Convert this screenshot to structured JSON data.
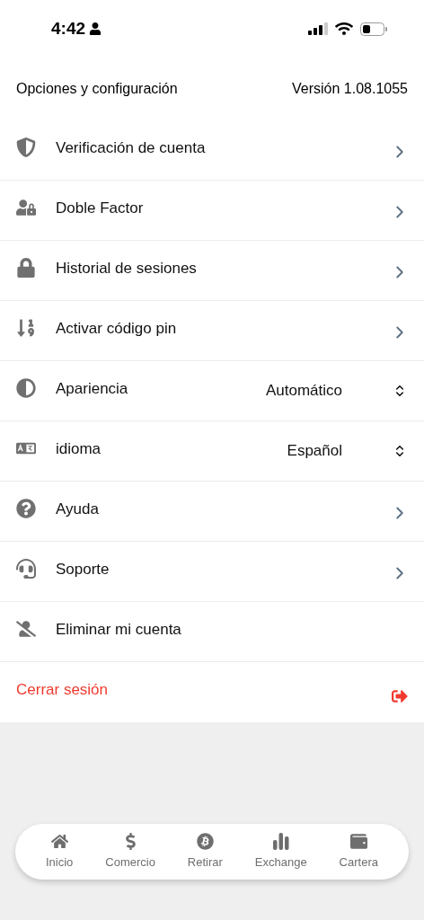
{
  "status_bar": {
    "time": "4:42"
  },
  "header": {
    "title": "Opciones y configuración",
    "version": "Versión 1.08.1055"
  },
  "items": [
    {
      "label": "Verificación de cuenta",
      "kind": "link"
    },
    {
      "label": "Doble Factor",
      "kind": "link"
    },
    {
      "label": "Historial de sesiones",
      "kind": "link"
    },
    {
      "label": "Activar código pin",
      "kind": "link"
    },
    {
      "label": "Apariencia",
      "kind": "select",
      "value": "Automático"
    },
    {
      "label": "idioma",
      "kind": "select",
      "value": "Español"
    },
    {
      "label": "Ayuda",
      "kind": "link"
    },
    {
      "label": "Soporte",
      "kind": "link"
    },
    {
      "label": "Eliminar mi cuenta",
      "kind": "plain"
    }
  ],
  "logout": {
    "label": "Cerrar sesión"
  },
  "tab_bar": [
    {
      "label": "Inicio"
    },
    {
      "label": "Comercio"
    },
    {
      "label": "Retirar"
    },
    {
      "label": "Exchange"
    },
    {
      "label": "Cartera"
    }
  ]
}
